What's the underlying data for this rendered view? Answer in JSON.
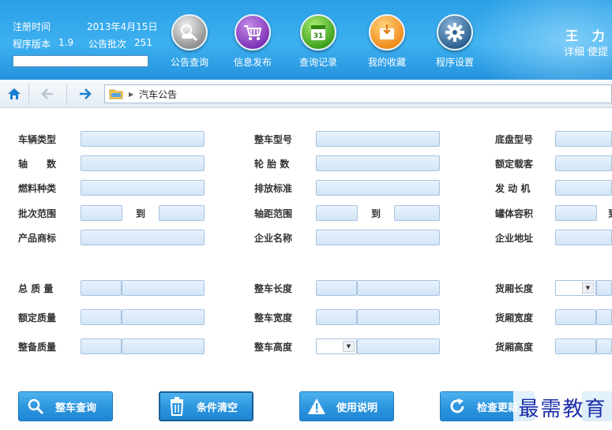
{
  "header": {
    "register_label": "注册时间",
    "register_date": "2013年4月15日",
    "version_label": "程序版本",
    "version_value": "1.9",
    "batch_label": "公告批次",
    "batch_value": "251",
    "progress_fraction": 0.0,
    "nav": [
      {
        "label": "公告查询",
        "icon": "car-search-icon"
      },
      {
        "label": "信息发布",
        "icon": "cart-icon"
      },
      {
        "label": "查询记录",
        "icon": "calendar-icon"
      },
      {
        "label": "我的收藏",
        "icon": "favorites-box-icon"
      },
      {
        "label": "程序设置",
        "icon": "gear-icon"
      }
    ],
    "user_name": "王 力 涛",
    "user_links": "详细 使提"
  },
  "toolbar": {
    "breadcrumb": "汽车公告"
  },
  "form": {
    "col1": [
      "车辆类型",
      "轴　　数",
      "燃料种类",
      "批次范围",
      "产品商标"
    ],
    "col2": [
      "整车型号",
      "轮 胎 数",
      "排放标准",
      "轴距范围",
      "企业名称"
    ],
    "col3": [
      "底盘型号",
      "额定载客",
      "发 动 机",
      "罐体容积",
      "企业地址"
    ],
    "to_label": "到",
    "dims1": [
      "总 质 量",
      "额定质量",
      "整备质量"
    ],
    "dims2": [
      "整车长度",
      "整车宽度",
      "整车高度"
    ],
    "dims3": [
      "货厢长度",
      "货厢宽度",
      "货厢高度"
    ]
  },
  "actions": {
    "query": "整车查询",
    "clear": "条件清空",
    "help": "使用说明",
    "update": "检查更新"
  },
  "watermark": "最需教育",
  "colors": {
    "header_blue": "#2a9fe6",
    "button_blue": "#2d97e0",
    "field_blue": "#d2e5f7"
  }
}
